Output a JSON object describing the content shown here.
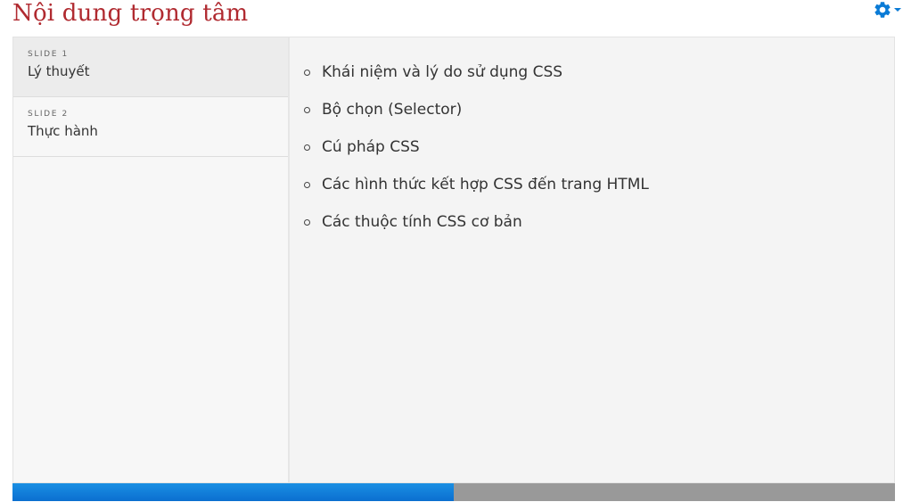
{
  "page": {
    "title": "Nội dung trọng tâm"
  },
  "settings": {
    "icon": "gear-icon",
    "dropdown_icon": "caret-down-icon",
    "accent_color": "#0a7bd6"
  },
  "sidebar": {
    "slides": [
      {
        "number": "SLIDE 1",
        "title": "Lý thuyết",
        "active": true
      },
      {
        "number": "SLIDE 2",
        "title": "Thực hành",
        "active": false
      }
    ]
  },
  "content": {
    "items": [
      "Khái niệm và lý do sử dụng CSS",
      "Bộ chọn (Selector)",
      "Cú pháp CSS",
      "Các hình thức kết hợp CSS đến trang HTML",
      "Các thuộc tính CSS cơ bản"
    ]
  },
  "progress": {
    "value": 0.5,
    "fill_color": "#0b7bd8",
    "track_color": "#999999"
  },
  "colors": {
    "title": "#b02a30"
  }
}
